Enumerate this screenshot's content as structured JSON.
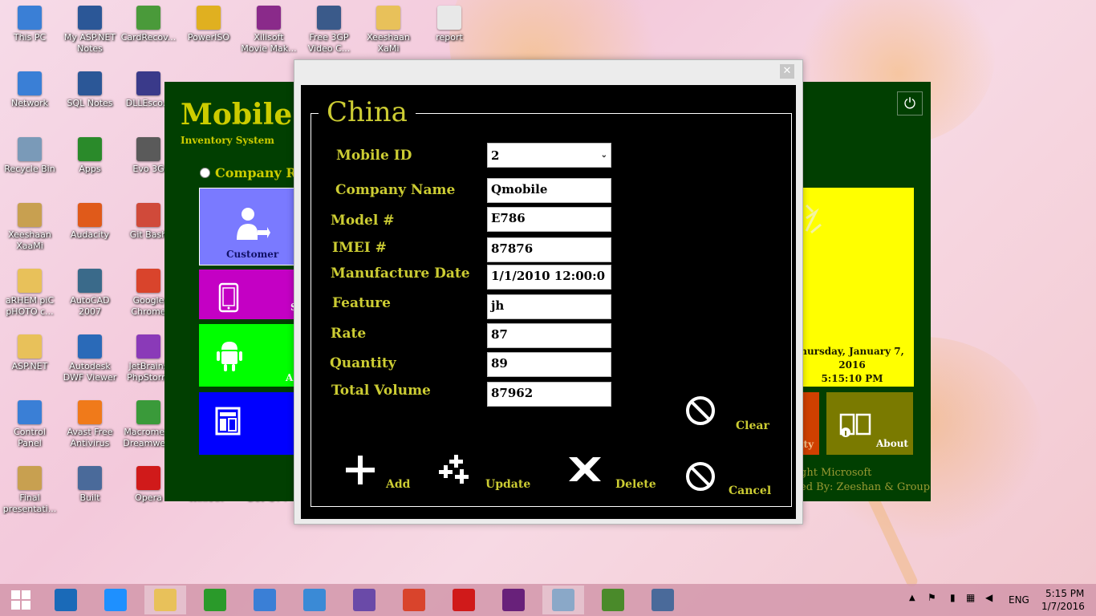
{
  "desktop": {
    "icons": [
      {
        "label": "This PC",
        "icon": "computer-icon",
        "color": "#3a7fd6"
      },
      {
        "label": "My ASP.NET Notes",
        "icon": "word-doc-icon",
        "color": "#2b5797"
      },
      {
        "label": "CardRecov...",
        "icon": "shortcut-icon",
        "color": "#4a9a3a"
      },
      {
        "label": "PowerISO",
        "icon": "disc-icon",
        "color": "#e0b020"
      },
      {
        "label": "Xilisoft Movie Mak...",
        "icon": "film-icon",
        "color": "#8a2a8a"
      },
      {
        "label": "Free 3GP Video C...",
        "icon": "phone-icon",
        "color": "#3a5a8a"
      },
      {
        "label": "Xeeshaan XaMi",
        "icon": "folder-icon",
        "color": "#e8c15a"
      },
      {
        "label": "report",
        "icon": "document-icon",
        "color": "#e8e8e8"
      },
      {
        "label": "Network",
        "icon": "network-icon",
        "color": "#3a7fd6"
      },
      {
        "label": "SQL Notes",
        "icon": "word-doc-icon",
        "color": "#2b5797"
      },
      {
        "label": "DLLEsco...",
        "icon": "shortcut-icon",
        "color": "#3a3a8a"
      },
      {
        "label": "Recycle Bin",
        "icon": "recycle-bin-icon",
        "color": "#7a9ab8"
      },
      {
        "label": "Apps",
        "icon": "apps-icon",
        "color": "#2a8a2a"
      },
      {
        "label": "Evo 3G",
        "icon": "shortcut-icon",
        "color": "#5a5a5a"
      },
      {
        "label": "Xeeshaan XaaMi",
        "icon": "user-icon",
        "color": "#c8a050"
      },
      {
        "label": "Audacity",
        "icon": "headphones-icon",
        "color": "#e05a1a"
      },
      {
        "label": "Git Bash",
        "icon": "git-icon",
        "color": "#d04a3a"
      },
      {
        "label": "aRHEM piC pHOTO c...",
        "icon": "folder-icon",
        "color": "#e8c15a"
      },
      {
        "label": "AutoCAD 2007",
        "icon": "autocad-icon",
        "color": "#3a6a8a"
      },
      {
        "label": "Google Chrome",
        "icon": "chrome-icon",
        "color": "#d9442c"
      },
      {
        "label": "ASP.NET",
        "icon": "folder-icon",
        "color": "#e8c15a"
      },
      {
        "label": "Autodesk DWF Viewer",
        "icon": "globe-icon",
        "color": "#2a6ab8"
      },
      {
        "label": "JetBrains PhpStorm",
        "icon": "shortcut-icon",
        "color": "#8a3ab8"
      },
      {
        "label": "Control Panel",
        "icon": "control-panel-icon",
        "color": "#3a7fd6"
      },
      {
        "label": "Avast Free Antivirus",
        "icon": "avast-icon",
        "color": "#f07a1a"
      },
      {
        "label": "Macrome... Dreamwe...",
        "icon": "dreamweaver-icon",
        "color": "#3a9a3a"
      },
      {
        "label": "Final presentati...",
        "icon": "presentation-icon",
        "color": "#c8a050"
      },
      {
        "label": "Built",
        "icon": "app-icon",
        "color": "#4a6a9a"
      },
      {
        "label": "Opera",
        "icon": "opera-icon",
        "color": "#d01a1a"
      }
    ],
    "partial_labels": [
      "WinRAR",
      "Dev-C++"
    ]
  },
  "app": {
    "brand": "Mobile",
    "brand_sub": "Inventory System",
    "radio_label": "Company Reco",
    "tiles": {
      "customer_label": "Customer",
      "about_label": "About",
      "partial_s": "S",
      "partial_a": "A",
      "partial_ity": "ity"
    },
    "clock": {
      "date_line1": "hursday, January 7,",
      "date_line2": "2016",
      "time": "5:15:10 PM"
    },
    "footer_line1": "ght Microsoft",
    "footer_line2": "ed By: Zeeshan & Group",
    "colors": {
      "background": "#013f01",
      "brand": "#cccc00",
      "customer_tile": "#7a7aff",
      "mobile_tile": "#c400c4",
      "android_tile": "#00ff00",
      "report_tile": "#0000ff",
      "clock_tile": "#ffff00",
      "about_tile": "#7a7a00",
      "orange_tile": "#d04000"
    }
  },
  "dialog": {
    "close_glyph": "✕",
    "legend": "China",
    "fields": {
      "mobile_id": {
        "label": "Mobile ID",
        "value": "2"
      },
      "company_name": {
        "label": "Company Name",
        "value": "Qmobile"
      },
      "model": {
        "label": "Model #",
        "value": "E786"
      },
      "imei": {
        "label": "IMEI #",
        "value": "87876"
      },
      "manufacture_date": {
        "label": "Manufacture Date",
        "value": "1/1/2010 12:00:0"
      },
      "feature": {
        "label": "Feature",
        "value": "jh"
      },
      "rate": {
        "label": "Rate",
        "value": "87"
      },
      "quantity": {
        "label": "Quantity",
        "value": "89"
      },
      "total_volume": {
        "label": "Total Volume",
        "value": "87962"
      }
    },
    "buttons": {
      "add": "Add",
      "update": "Update",
      "delete": "Delete",
      "clear": "Clear",
      "cancel": "Cancel"
    }
  },
  "taskbar": {
    "items": [
      {
        "name": "ie-logo",
        "color": "#1a6ab8"
      },
      {
        "name": "internet-explorer",
        "color": "#1e90ff"
      },
      {
        "name": "file-explorer",
        "color": "#e8c15a"
      },
      {
        "name": "store",
        "color": "#2a9a2a"
      },
      {
        "name": "control-panel",
        "color": "#3a7fd6"
      },
      {
        "name": "app-blue",
        "color": "#3a8ad6"
      },
      {
        "name": "app-hex",
        "color": "#6a4aa8"
      },
      {
        "name": "chrome",
        "color": "#d9442c"
      },
      {
        "name": "opera",
        "color": "#d01a1a"
      },
      {
        "name": "visual-studio",
        "color": "#68217a"
      },
      {
        "name": "paint",
        "color": "#8aa8c8"
      },
      {
        "name": "winrar",
        "color": "#4a8a2a"
      },
      {
        "name": "window",
        "color": "#4a6a9a"
      }
    ],
    "language": "ENG",
    "time": "5:15 PM",
    "date": "1/7/2016"
  }
}
